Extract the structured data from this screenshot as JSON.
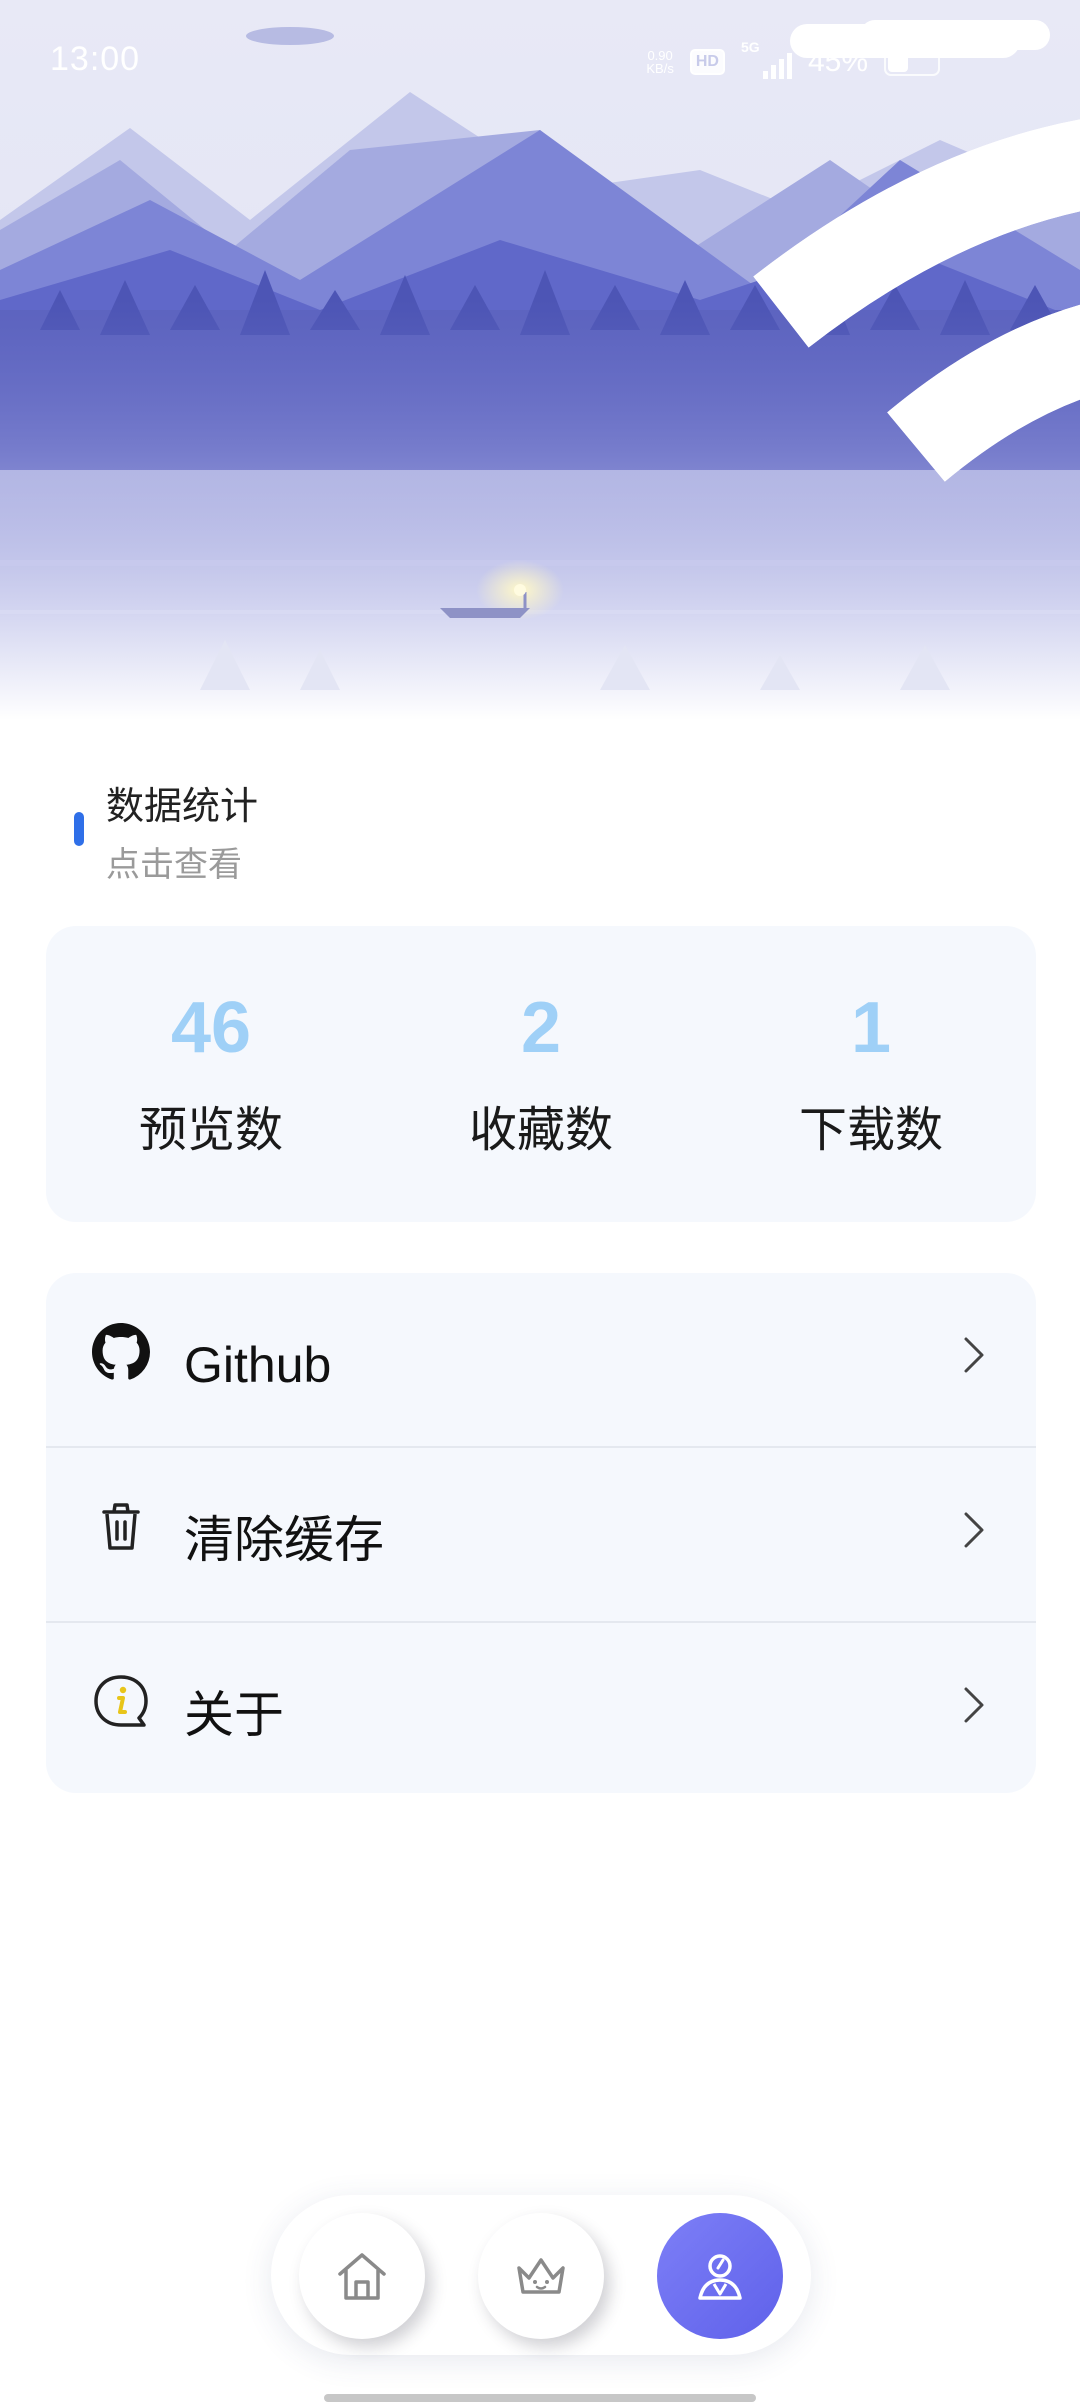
{
  "status_bar": {
    "time": "13:00",
    "net_speed_value": "0.90",
    "net_speed_unit": "KB/s",
    "hd_badge": "HD",
    "network_type": "5G",
    "battery_percent": "45%"
  },
  "section": {
    "title": "数据统计",
    "subtitle": "点击查看",
    "accent_color": "#2f6fe8"
  },
  "stats": [
    {
      "value": "46",
      "label": "预览数"
    },
    {
      "value": "2",
      "label": "收藏数"
    },
    {
      "value": "1",
      "label": "下载数"
    }
  ],
  "stats_value_color": "#9fd0f7",
  "menu": [
    {
      "icon": "github-icon",
      "label": "Github"
    },
    {
      "icon": "trash-icon",
      "label": "清除缓存"
    },
    {
      "icon": "info-bubble-icon",
      "label": "关于"
    }
  ],
  "bottom_nav": {
    "items": [
      {
        "icon": "home-icon",
        "active": false
      },
      {
        "icon": "crown-icon",
        "active": false
      },
      {
        "icon": "user-icon",
        "active": true
      }
    ],
    "active_color": "#6466ee"
  }
}
